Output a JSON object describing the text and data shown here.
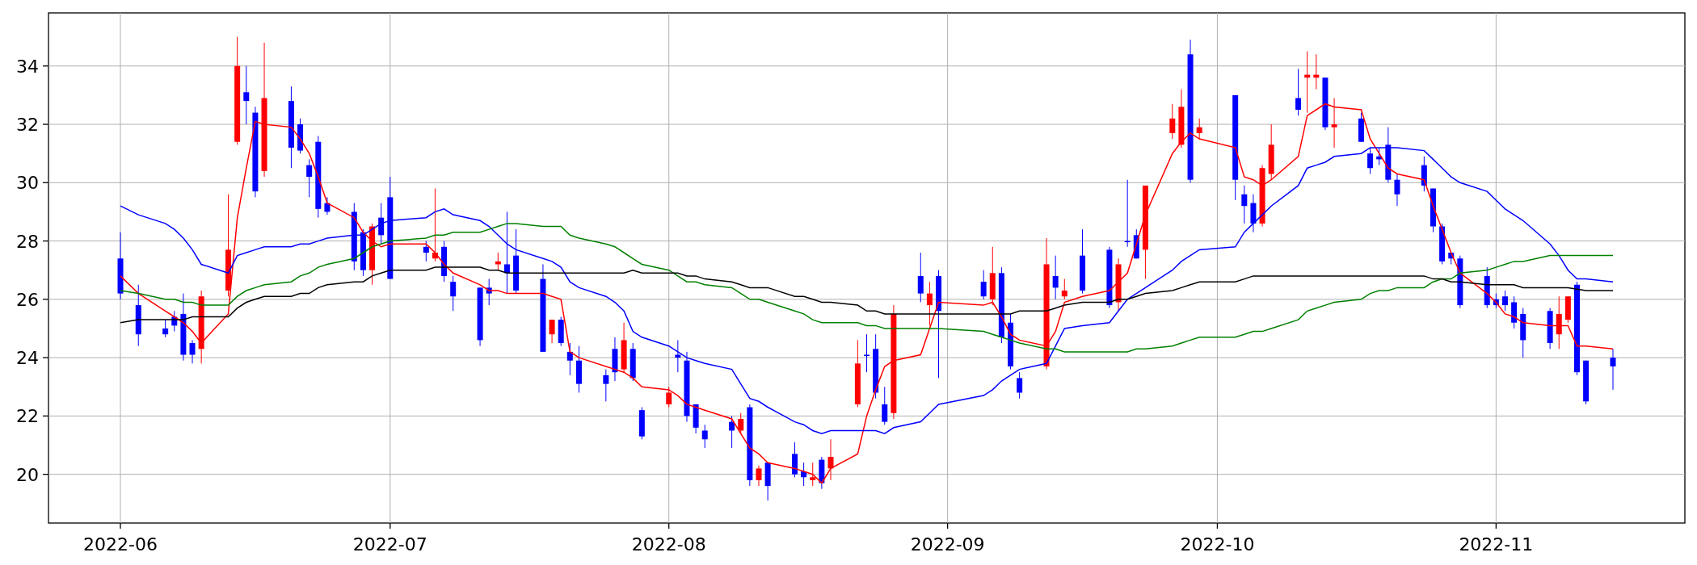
{
  "figure": {
    "chart_data": {
      "type": "candlestick",
      "grid": true,
      "x": [
        "2022-06-01",
        "2022-06-03",
        "2022-06-06",
        "2022-06-07",
        "2022-06-08",
        "2022-06-09",
        "2022-06-10",
        "2022-06-13",
        "2022-06-14",
        "2022-06-15",
        "2022-06-16",
        "2022-06-17",
        "2022-06-20",
        "2022-06-21",
        "2022-06-22",
        "2022-06-23",
        "2022-06-24",
        "2022-06-27",
        "2022-06-28",
        "2022-06-29",
        "2022-06-30",
        "2022-07-01",
        "2022-07-05",
        "2022-07-06",
        "2022-07-07",
        "2022-07-08",
        "2022-07-11",
        "2022-07-12",
        "2022-07-13",
        "2022-07-14",
        "2022-07-15",
        "2022-07-18",
        "2022-07-19",
        "2022-07-20",
        "2022-07-21",
        "2022-07-22",
        "2022-07-25",
        "2022-07-26",
        "2022-07-27",
        "2022-07-28",
        "2022-07-29",
        "2022-08-01",
        "2022-08-02",
        "2022-08-03",
        "2022-08-04",
        "2022-08-05",
        "2022-08-08",
        "2022-08-09",
        "2022-08-10",
        "2022-08-11",
        "2022-08-12",
        "2022-08-15",
        "2022-08-16",
        "2022-08-17",
        "2022-08-18",
        "2022-08-19",
        "2022-08-22",
        "2022-08-23",
        "2022-08-24",
        "2022-08-25",
        "2022-08-26",
        "2022-08-29",
        "2022-08-30",
        "2022-08-31",
        "2022-09-05",
        "2022-09-06",
        "2022-09-07",
        "2022-09-08",
        "2022-09-09",
        "2022-09-12",
        "2022-09-13",
        "2022-09-14",
        "2022-09-16",
        "2022-09-19",
        "2022-09-20",
        "2022-09-21",
        "2022-09-22",
        "2022-09-23",
        "2022-09-26",
        "2022-09-27",
        "2022-09-28",
        "2022-09-29",
        "2022-10-03",
        "2022-10-04",
        "2022-10-05",
        "2022-10-06",
        "2022-10-07",
        "2022-10-10",
        "2022-10-11",
        "2022-10-12",
        "2022-10-13",
        "2022-10-14",
        "2022-10-17",
        "2022-10-18",
        "2022-10-19",
        "2022-10-20",
        "2022-10-21",
        "2022-10-24",
        "2022-10-25",
        "2022-10-26",
        "2022-10-27",
        "2022-10-28",
        "2022-10-31",
        "2022-11-01",
        "2022-11-02",
        "2022-11-03",
        "2022-11-04",
        "2022-11-07",
        "2022-11-08",
        "2022-11-09",
        "2022-11-10",
        "2022-11-11",
        "2022-11-14"
      ],
      "ohlc": [
        [
          27.4,
          28.3,
          26.0,
          26.2
        ],
        [
          25.8,
          26.5,
          24.4,
          24.8
        ],
        [
          25.0,
          25.3,
          24.7,
          24.8
        ],
        [
          25.4,
          25.6,
          24.9,
          25.1
        ],
        [
          25.5,
          26.2,
          23.9,
          24.1
        ],
        [
          24.5,
          24.6,
          23.8,
          24.1
        ],
        [
          24.3,
          26.3,
          23.8,
          26.1
        ],
        [
          26.3,
          29.6,
          26.1,
          27.7
        ],
        [
          31.4,
          35.0,
          31.3,
          34.0
        ],
        [
          33.1,
          34.0,
          32.0,
          32.8
        ],
        [
          32.4,
          32.6,
          29.5,
          29.7
        ],
        [
          30.4,
          34.8,
          30.2,
          32.9
        ],
        [
          32.8,
          33.3,
          30.5,
          31.2
        ],
        [
          32.0,
          32.2,
          31.0,
          31.1
        ],
        [
          30.6,
          30.8,
          29.5,
          30.2
        ],
        [
          31.4,
          31.6,
          28.8,
          29.1
        ],
        [
          29.3,
          29.5,
          28.9,
          29.0
        ],
        [
          29.0,
          29.3,
          27.0,
          27.3
        ],
        [
          28.3,
          28.4,
          26.8,
          27.0
        ],
        [
          27.0,
          28.6,
          26.5,
          28.5
        ],
        [
          28.8,
          29.3,
          27.9,
          28.2
        ],
        [
          29.5,
          30.2,
          26.7,
          26.7
        ],
        [
          27.8,
          28.0,
          27.3,
          27.6
        ],
        [
          27.4,
          29.8,
          27.3,
          27.6
        ],
        [
          27.8,
          28.0,
          26.6,
          26.8
        ],
        [
          26.6,
          26.8,
          25.6,
          26.1
        ],
        [
          26.4,
          26.4,
          24.4,
          24.6
        ],
        [
          26.4,
          26.7,
          25.8,
          26.2
        ],
        [
          27.2,
          27.6,
          27.0,
          27.3
        ],
        [
          27.2,
          29.0,
          26.2,
          26.9
        ],
        [
          27.5,
          28.4,
          26.2,
          26.3
        ],
        [
          26.7,
          27.2,
          24.2,
          24.2
        ],
        [
          24.8,
          25.3,
          24.5,
          25.3
        ],
        [
          25.3,
          25.4,
          24.4,
          24.5
        ],
        [
          24.2,
          24.5,
          23.4,
          23.9
        ],
        [
          23.9,
          24.4,
          22.8,
          23.1
        ],
        [
          23.4,
          23.6,
          22.5,
          23.1
        ],
        [
          24.3,
          24.7,
          23.2,
          23.5
        ],
        [
          23.6,
          25.2,
          23.5,
          24.6
        ],
        [
          24.3,
          24.5,
          23.2,
          23.3
        ],
        [
          22.2,
          22.3,
          21.2,
          21.3
        ],
        [
          22.4,
          23.0,
          22.3,
          22.8
        ],
        [
          24.1,
          24.6,
          23.5,
          24.0
        ],
        [
          23.9,
          24.2,
          21.8,
          22.0
        ],
        [
          22.4,
          22.4,
          21.4,
          21.6
        ],
        [
          21.5,
          21.7,
          20.9,
          21.2
        ],
        [
          21.8,
          22.0,
          20.9,
          21.5
        ],
        [
          21.5,
          22.1,
          21.4,
          21.9
        ],
        [
          22.3,
          22.4,
          19.6,
          19.8
        ],
        [
          19.8,
          20.3,
          19.6,
          20.2
        ],
        [
          20.4,
          20.4,
          19.1,
          19.6
        ],
        [
          20.7,
          21.1,
          19.9,
          20.0
        ],
        [
          20.1,
          20.4,
          19.6,
          19.9
        ],
        [
          19.8,
          20.4,
          19.6,
          19.9
        ],
        [
          20.5,
          20.6,
          19.5,
          19.7
        ],
        [
          20.2,
          21.2,
          19.8,
          20.6
        ],
        [
          22.4,
          24.6,
          22.3,
          23.8
        ],
        [
          24.1,
          24.8,
          23.5,
          24.1
        ],
        [
          24.3,
          24.8,
          22.6,
          22.8
        ],
        [
          22.4,
          23.0,
          21.7,
          21.8
        ],
        [
          22.1,
          25.8,
          21.9,
          25.5
        ],
        [
          26.8,
          27.6,
          25.9,
          26.2
        ],
        [
          25.8,
          26.6,
          25.1,
          26.2
        ],
        [
          26.8,
          27.0,
          23.3,
          25.6
        ],
        [
          26.6,
          27.0,
          26.0,
          26.1
        ],
        [
          26.0,
          27.8,
          25.8,
          26.9
        ],
        [
          26.9,
          27.1,
          24.5,
          24.7
        ],
        [
          25.2,
          25.5,
          23.6,
          23.7
        ],
        [
          23.3,
          23.5,
          22.6,
          22.8
        ],
        [
          23.7,
          28.1,
          23.6,
          27.2
        ],
        [
          26.8,
          27.5,
          26.0,
          26.4
        ],
        [
          26.1,
          26.7,
          26.0,
          26.3
        ],
        [
          27.5,
          28.4,
          26.2,
          26.3
        ],
        [
          27.7,
          27.8,
          25.7,
          25.8
        ],
        [
          25.9,
          27.4,
          25.6,
          27.2
        ],
        [
          28.0,
          30.1,
          27.8,
          28.0
        ],
        [
          28.2,
          28.4,
          27.4,
          27.4
        ],
        [
          27.7,
          29.9,
          26.7,
          29.9
        ],
        [
          31.7,
          32.7,
          31.5,
          32.2
        ],
        [
          31.3,
          33.2,
          31.2,
          32.6
        ],
        [
          34.4,
          34.9,
          30.0,
          30.1
        ],
        [
          31.7,
          32.2,
          31.5,
          31.9
        ],
        [
          33.0,
          33.0,
          29.4,
          30.1
        ],
        [
          29.6,
          29.9,
          28.6,
          29.2
        ],
        [
          29.3,
          29.6,
          28.3,
          28.6
        ],
        [
          28.6,
          30.6,
          28.5,
          30.5
        ],
        [
          30.3,
          32.0,
          30.1,
          31.3
        ],
        [
          32.9,
          33.9,
          32.3,
          32.5
        ],
        [
          33.6,
          34.5,
          32.4,
          33.7
        ],
        [
          33.6,
          34.4,
          33.2,
          33.7
        ],
        [
          33.6,
          33.6,
          31.8,
          31.9
        ],
        [
          31.9,
          32.9,
          31.2,
          32.0
        ],
        [
          32.2,
          32.4,
          31.4,
          31.4
        ],
        [
          31.0,
          31.2,
          30.3,
          30.5
        ],
        [
          30.9,
          31.2,
          30.6,
          30.8
        ],
        [
          31.3,
          31.9,
          30.0,
          30.1
        ],
        [
          30.1,
          30.3,
          29.2,
          29.6
        ],
        [
          30.6,
          30.9,
          29.7,
          29.9
        ],
        [
          29.8,
          29.8,
          28.3,
          28.5
        ],
        [
          28.5,
          28.6,
          27.2,
          27.3
        ],
        [
          27.6,
          27.6,
          27.2,
          27.4
        ],
        [
          27.4,
          27.5,
          25.7,
          25.8
        ],
        [
          26.8,
          27.1,
          25.7,
          25.8
        ],
        [
          26.0,
          26.2,
          25.7,
          25.8
        ],
        [
          26.1,
          26.3,
          25.6,
          25.8
        ],
        [
          25.9,
          26.1,
          25.0,
          25.2
        ],
        [
          25.5,
          25.7,
          24.0,
          24.6
        ],
        [
          25.6,
          25.7,
          24.3,
          24.5
        ],
        [
          24.8,
          26.1,
          24.3,
          25.5
        ],
        [
          25.3,
          26.1,
          25.2,
          26.1
        ],
        [
          26.5,
          26.6,
          23.4,
          23.5
        ],
        [
          23.9,
          23.9,
          22.4,
          22.5
        ],
        [
          24.0,
          24.3,
          22.9,
          23.7
        ]
      ],
      "series": [
        {
          "type": "line",
          "color": "#ff0000",
          "values": [
            26.8,
            26.2,
            25.6,
            25.4,
            25.2,
            24.9,
            24.5,
            25.5,
            28.8,
            30.5,
            32.1,
            32.0,
            31.9,
            31.5,
            31.0,
            30.2,
            29.3,
            28.8,
            28.3,
            28.0,
            27.8,
            27.9,
            27.9,
            27.6,
            27.2,
            26.9,
            26.5,
            26.3,
            26.3,
            26.2,
            26.2,
            26.2,
            26.1,
            26.0,
            24.2,
            24.0,
            23.7,
            23.6,
            23.5,
            23.3,
            23.0,
            22.9,
            22.7,
            22.4,
            22.3,
            22.2,
            21.9,
            21.4,
            20.9,
            20.7,
            20.4,
            20.2,
            20.1,
            20.0,
            19.7,
            20.2,
            20.7,
            22.0,
            22.9,
            23.7,
            23.9,
            24.1,
            25.0,
            25.9,
            25.8,
            25.9,
            25.4,
            24.8,
            24.6,
            24.4,
            24.9,
            25.9,
            26.1,
            26.3,
            26.6,
            26.9,
            27.9,
            28.9,
            31.0,
            31.4,
            31.7,
            31.5,
            31.2,
            30.2,
            30.1,
            29.9,
            30.1,
            30.9,
            32.3,
            32.5,
            32.7,
            32.6,
            32.5,
            31.5,
            31.0,
            30.5,
            30.3,
            30.1,
            29.2,
            28.4,
            27.6,
            26.9,
            26.2,
            25.9,
            25.5,
            25.4,
            25.2,
            25.1,
            25.1,
            25.1,
            24.4,
            24.4,
            24.3
          ]
        },
        {
          "type": "line",
          "color": "#0000ff",
          "values": [
            29.2,
            28.9,
            28.6,
            28.4,
            28.1,
            27.7,
            27.2,
            26.9,
            27.5,
            27.6,
            27.7,
            27.8,
            27.8,
            27.9,
            27.9,
            28.0,
            28.1,
            28.2,
            28.2,
            28.4,
            28.6,
            28.7,
            28.8,
            29.0,
            29.1,
            28.9,
            28.7,
            28.5,
            28.2,
            27.9,
            27.7,
            27.4,
            27.3,
            27.1,
            26.6,
            26.4,
            26.1,
            25.9,
            25.6,
            24.9,
            24.7,
            24.4,
            24.2,
            24.0,
            23.9,
            23.8,
            23.6,
            23.1,
            22.6,
            22.5,
            22.3,
            21.8,
            21.7,
            21.5,
            21.4,
            21.5,
            21.5,
            21.5,
            21.5,
            21.4,
            21.6,
            21.8,
            22.1,
            22.4,
            22.7,
            22.9,
            23.2,
            23.4,
            23.6,
            23.8,
            24.4,
            25.0,
            25.1,
            25.2,
            25.6,
            26.0,
            26.2,
            26.4,
            27.0,
            27.3,
            27.5,
            27.7,
            27.8,
            28.3,
            28.6,
            28.9,
            29.2,
            29.9,
            30.5,
            30.6,
            30.7,
            30.9,
            31.0,
            31.2,
            31.2,
            31.2,
            31.2,
            31.1,
            30.8,
            30.5,
            30.2,
            30.0,
            29.7,
            29.4,
            29.1,
            28.9,
            28.7,
            27.9,
            27.5,
            27.0,
            26.7,
            26.7,
            26.6
          ]
        },
        {
          "type": "line",
          "color": "#008000",
          "values": [
            26.3,
            26.2,
            26.0,
            26.0,
            25.9,
            25.9,
            25.8,
            25.8,
            26.1,
            26.3,
            26.4,
            26.5,
            26.6,
            26.8,
            26.9,
            27.1,
            27.2,
            27.4,
            27.6,
            27.8,
            27.9,
            28.0,
            28.1,
            28.2,
            28.2,
            28.3,
            28.3,
            28.4,
            28.5,
            28.6,
            28.6,
            28.5,
            28.5,
            28.5,
            28.2,
            28.1,
            27.9,
            27.8,
            27.6,
            27.4,
            27.2,
            27.0,
            26.8,
            26.6,
            26.6,
            26.5,
            26.4,
            26.2,
            26.0,
            26.0,
            25.9,
            25.6,
            25.5,
            25.3,
            25.2,
            25.2,
            25.2,
            25.1,
            25.1,
            25.0,
            25.0,
            25.0,
            25.0,
            25.0,
            24.9,
            24.8,
            24.7,
            24.6,
            24.5,
            24.3,
            24.3,
            24.2,
            24.2,
            24.2,
            24.2,
            24.2,
            24.3,
            24.3,
            24.4,
            24.5,
            24.6,
            24.7,
            24.7,
            24.8,
            24.9,
            24.9,
            25.0,
            25.3,
            25.6,
            25.7,
            25.8,
            25.9,
            26.0,
            26.2,
            26.3,
            26.3,
            26.4,
            26.4,
            26.6,
            26.7,
            26.7,
            26.9,
            27.0,
            27.1,
            27.2,
            27.3,
            27.3,
            27.5,
            27.5,
            27.5,
            27.5,
            27.5,
            27.5
          ]
        },
        {
          "type": "line",
          "color": "#000000",
          "values": [
            25.2,
            25.3,
            25.3,
            25.3,
            25.3,
            25.4,
            25.4,
            25.4,
            25.7,
            25.9,
            26.0,
            26.1,
            26.1,
            26.2,
            26.2,
            26.4,
            26.5,
            26.6,
            26.6,
            26.8,
            26.9,
            27.0,
            27.0,
            27.1,
            27.1,
            27.1,
            27.1,
            27.0,
            27.0,
            26.9,
            26.9,
            26.9,
            26.9,
            26.9,
            26.9,
            26.9,
            26.9,
            26.9,
            26.9,
            27.0,
            26.9,
            26.9,
            26.9,
            26.8,
            26.8,
            26.7,
            26.6,
            26.5,
            26.4,
            26.4,
            26.4,
            26.1,
            26.1,
            26.0,
            25.9,
            25.9,
            25.8,
            25.6,
            25.6,
            25.5,
            25.5,
            25.5,
            25.5,
            25.5,
            25.5,
            25.5,
            25.5,
            25.5,
            25.6,
            25.6,
            25.7,
            25.8,
            25.9,
            25.9,
            26.0,
            26.0,
            26.1,
            26.2,
            26.3,
            26.4,
            26.5,
            26.6,
            26.6,
            26.7,
            26.8,
            26.8,
            26.8,
            26.8,
            26.8,
            26.8,
            26.8,
            26.8,
            26.8,
            26.8,
            26.8,
            26.8,
            26.8,
            26.8,
            26.7,
            26.7,
            26.6,
            26.6,
            26.5,
            26.5,
            26.5,
            26.5,
            26.4,
            26.4,
            26.4,
            26.4,
            26.35,
            26.3,
            26.3
          ]
        }
      ],
      "xlim": [
        "2022-05-24",
        "2022-11-22"
      ],
      "ylim": [
        18.33,
        35.82
      ],
      "xticks": [
        {
          "value": "2022-06-01",
          "label": "2022-06"
        },
        {
          "value": "2022-07-01",
          "label": "2022-07"
        },
        {
          "value": "2022-08-01",
          "label": "2022-08"
        },
        {
          "value": "2022-09-01",
          "label": "2022-09"
        },
        {
          "value": "2022-10-01",
          "label": "2022-10"
        },
        {
          "value": "2022-11-01",
          "label": "2022-11"
        }
      ],
      "yticks": [
        20,
        22,
        24,
        26,
        28,
        30,
        32,
        34
      ]
    }
  }
}
